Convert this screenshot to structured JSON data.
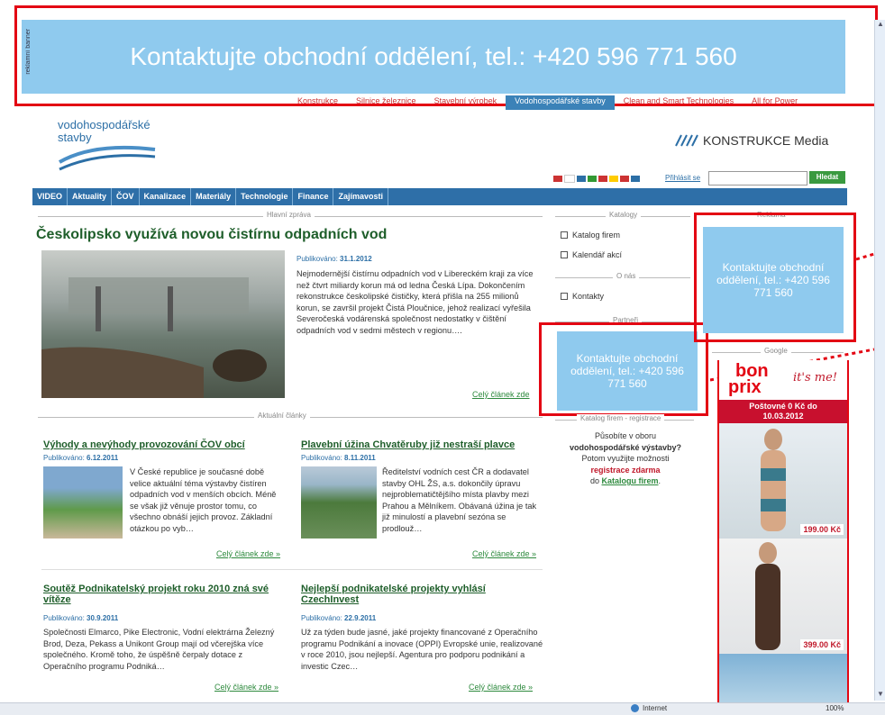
{
  "colors": {
    "banner": "#8fcaee",
    "nav": "#2e6fa8",
    "headline": "#1e5e2a",
    "highlight": "#e30613"
  },
  "top_banner": {
    "tag": "reklamní banner",
    "text": "Kontaktujte obchodní oddělení, tel.: +420 596 771 560"
  },
  "portal_tabs": [
    "Konstrukce",
    "Silnice železnice",
    "Stavební výrobek",
    "Vodohospodářské stavby",
    "Clean and Smart Technologies",
    "All for Power"
  ],
  "logo": {
    "line1": "vodohospodářské",
    "line2": "stavby"
  },
  "publisher": "KONSTRUKCE Media",
  "search": {
    "login_link": "Přihlásit se",
    "button": "Hledat"
  },
  "nav": [
    "VIDEO",
    "Aktuality",
    "ČOV",
    "Kanalizace",
    "Materiály",
    "Technologie",
    "Finance",
    "Zajímavosti"
  ],
  "main_story": {
    "section": "Hlavní zpráva",
    "title": "Českolipsko využívá novou čistírnu odpadních vod",
    "pub_label": "Publikováno:",
    "date": "31.1.2012",
    "text": "Nejmodernější čistírnu odpadních vod v Libereckém kraji za více než čtvrt miliardy korun má od ledna Česká Lípa. Dokončením rekonstrukce českolipské čističky, která přišla na 255 milionů korun, se završil projekt Čistá Ploučnice, jehož realizací vyřešila Severočeská vodárenská společnost nedostatky v čištění odpadních vod v sedmi městech v regionu….",
    "more": "Celý článek zde"
  },
  "news_section": "Aktuální články",
  "articles": [
    {
      "title": "Výhody a nevýhody provozování ČOV obcí",
      "pub_label": "Publikováno:",
      "date": "6.12.2011",
      "text": "V České republice je současné době velice aktuální téma výstavby čistíren odpadních vod v menších obcích. Méně se však již věnuje prostor tomu, co všechno obnáší jejich provoz. Základní otázkou po vyb…",
      "more": "Celý článek zde »"
    },
    {
      "title": "Plavební úžina Chvatěruby již nestraší plavce",
      "pub_label": "Publikováno:",
      "date": "8.11.2011",
      "text": "Ředitelství vodních cest ČR a dodavatel stavby OHL ŽS, a.s. dokončily úpravu nejproblematičtějšího místa plavby mezi Prahou a Mělníkem. Obávaná úžina je tak již minulostí a plavební sezóna se prodlouž…",
      "more": "Celý článek zde »"
    },
    {
      "title": "Soutěž Podnikatelský projekt roku 2010 zná své vítěze",
      "pub_label": "Publikováno:",
      "date": "30.9.2011",
      "text": "Společnosti Elmarco, Pike Electronic, Vodní elektrárna Železný Brod, Deza, Pekass a Unikont Group mají od včerejška více společného. Kromě toho, že úspěšně čerpaly dotace z Operačního programu Podniká…",
      "more": "Celý článek zde »"
    },
    {
      "title": "Nejlepší podnikatelské projekty vyhlásí CzechInvest",
      "pub_label": "Publikováno:",
      "date": "22.9.2011",
      "text": "Už za týden bude jasné, jaké projekty financované z Operačního programu Podnikání a inovace (OPPI) Evropské unie, realizované v roce 2010, jsou nejlepší. Agentura pro podporu podnikání a investic Czec…",
      "more": "Celý článek zde »"
    }
  ],
  "sidebar": {
    "catalogs_label": "Katalogy",
    "catalog_items": [
      "Katalog firem",
      "Kalendář akcí"
    ],
    "about_label": "O nás",
    "about_items": [
      "Kontakty"
    ],
    "partner_label": "Partneři",
    "banner_mid": "Kontaktujte obchodní oddělení, tel.: +420 596 771 560",
    "register_label": "Katalog firem - registrace",
    "register_l1": "Působíte v oboru",
    "register_l2": "vodohospodářské výstavby?",
    "register_l3": "Potom využijte možnosti",
    "register_l4": "registrace zdarma",
    "register_l5": "do",
    "register_link": "Katalogu firem",
    "register_end": "."
  },
  "right_col": {
    "reklama_label": "Reklama",
    "banner_right": "Kontaktujte obchodní oddělení, tel.: +420 596 771 560",
    "google_label": "Google",
    "ad_logo1": "bon",
    "ad_logo2": "prix",
    "ad_slogan": "it's me!",
    "ad_promo": "Poštovné 0 Kč do 10.03.2012",
    "ad_prices": [
      "199.00 Kč",
      "399.00 Kč"
    ]
  },
  "statusbar": {
    "zone": "Internet",
    "zoom": "100%"
  }
}
